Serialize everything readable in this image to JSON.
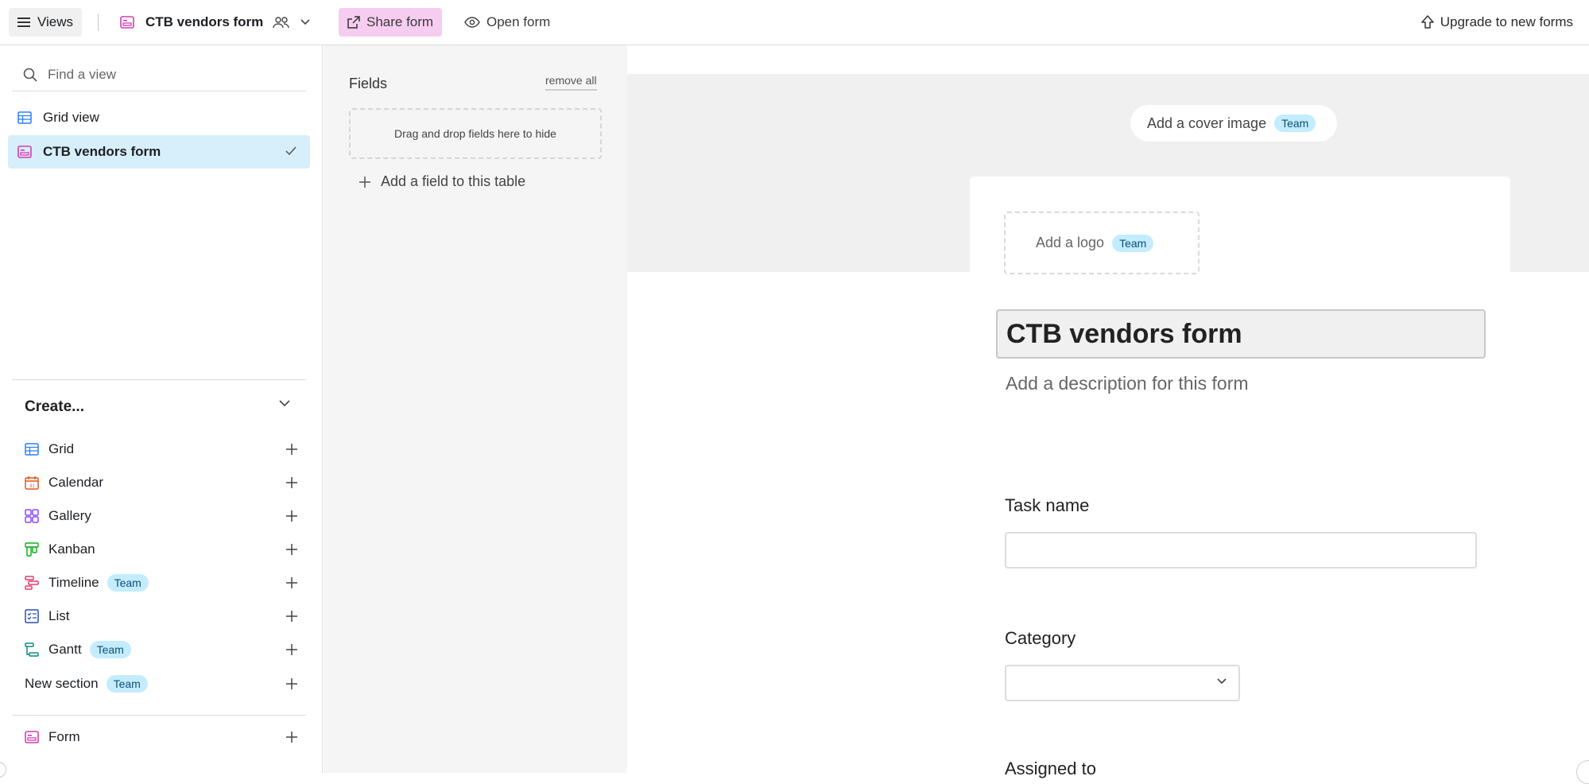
{
  "topbar": {
    "views_label": "Views",
    "view_name": "CTB vendors form",
    "share_label": "Share form",
    "open_label": "Open form",
    "upgrade_label": "Upgrade to new forms"
  },
  "sidebar": {
    "search_placeholder": "Find a view",
    "views": [
      {
        "label": "Grid view",
        "icon": "grid-icon",
        "active": false
      },
      {
        "label": "CTB vendors form",
        "icon": "form-icon",
        "active": true
      }
    ],
    "create_title": "Create...",
    "create_items": [
      {
        "label": "Grid",
        "icon": "grid-icon",
        "badge": ""
      },
      {
        "label": "Calendar",
        "icon": "calendar-icon",
        "badge": ""
      },
      {
        "label": "Gallery",
        "icon": "gallery-icon",
        "badge": ""
      },
      {
        "label": "Kanban",
        "icon": "kanban-icon",
        "badge": ""
      },
      {
        "label": "Timeline",
        "icon": "timeline-icon",
        "badge": "Team"
      },
      {
        "label": "List",
        "icon": "list-icon",
        "badge": ""
      },
      {
        "label": "Gantt",
        "icon": "gantt-icon",
        "badge": "Team"
      }
    ],
    "new_section": {
      "label": "New section",
      "badge": "Team"
    },
    "form_item": {
      "label": "Form",
      "icon": "form-icon"
    }
  },
  "fields_panel": {
    "title": "Fields",
    "remove_all": "remove all",
    "dropzone_text": "Drag and drop fields here to hide",
    "add_field": "Add a field to this table"
  },
  "form": {
    "cover_label": "Add a cover image",
    "cover_badge": "Team",
    "logo_label": "Add a logo",
    "logo_badge": "Team",
    "title": "CTB vendors form",
    "description": "Add a description for this form",
    "fields": [
      {
        "label": "Task name",
        "type": "text",
        "value": ""
      },
      {
        "label": "Category",
        "type": "select",
        "value": ""
      },
      {
        "label": "Assigned to",
        "type": "user",
        "value": ""
      }
    ]
  },
  "colors": {
    "accent_pink": "#f6cdf1",
    "active_view_bg": "#d6effa",
    "badge_bg": "#c4ecff",
    "badge_text": "#0b4f73"
  }
}
